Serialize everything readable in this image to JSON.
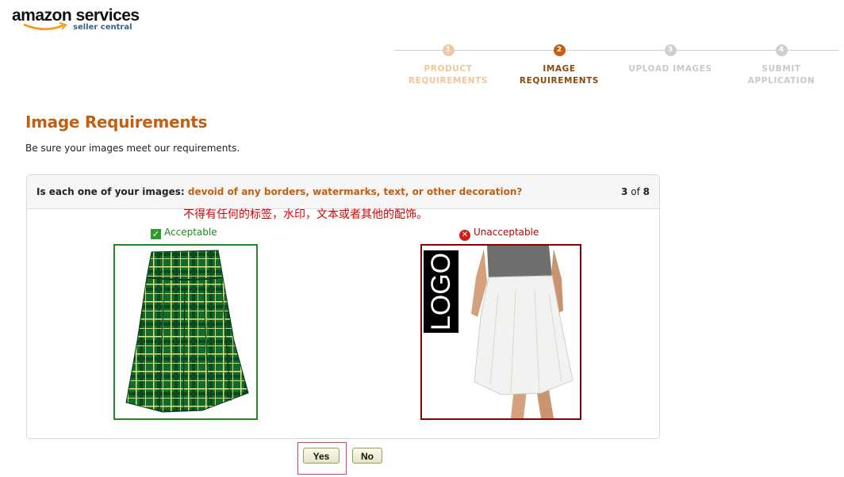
{
  "header": {
    "logo_word": "amazon services",
    "logo_sub": "seller central"
  },
  "steps": [
    {
      "num": "1",
      "label": "PRODUCT\nREQUIREMENTS",
      "state": "done"
    },
    {
      "num": "2",
      "label": "IMAGE\nREQUIREMENTS",
      "state": "active"
    },
    {
      "num": "3",
      "label": "UPLOAD IMAGES",
      "state": "todo"
    },
    {
      "num": "4",
      "label": "SUBMIT\nAPPLICATION",
      "state": "todo"
    }
  ],
  "page": {
    "title": "Image Requirements",
    "subtitle": "Be sure your images meet our requirements."
  },
  "question": {
    "prefix": "Is each one of your images:",
    "highlight": "devoid of any borders, watermarks, text, or other decoration?",
    "current": "3",
    "of_word": "of",
    "total": "8"
  },
  "annotation": "不得有任何的标签，水印，文本或者其他的配饰。",
  "examples": {
    "acceptable_label": "Acceptable",
    "unacceptable_label": "Unacceptable",
    "logo_text": "LOGO"
  },
  "buttons": {
    "yes": "Yes",
    "no": "No"
  },
  "colors": {
    "accent": "#c45f11",
    "acceptable": "#1f8a1f",
    "unacceptable": "#8b0000"
  }
}
